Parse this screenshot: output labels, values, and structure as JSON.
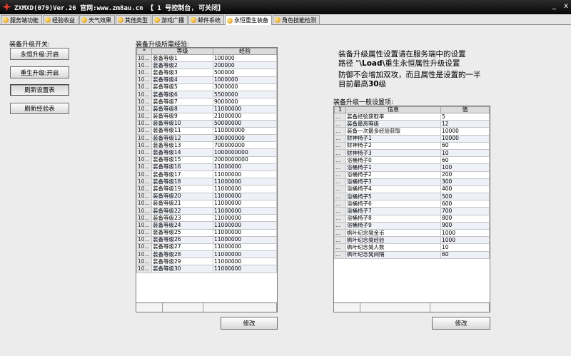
{
  "window": {
    "title": "ZXMXD(079)Ver.26 官网:www.zm8au.cn 【 1 号控制台, 可关闭】",
    "min_symbol": "_",
    "close_symbol": "x"
  },
  "tabs": [
    "服务端功能",
    "经验收益",
    "天气效果",
    "其他类型",
    "游戏广播",
    "邮件系统",
    "永恒重生装备",
    "角色技能检测"
  ],
  "left": {
    "section_label": "装备升级开关:",
    "btn_eternal": "永恒升级:开启",
    "btn_rebirth": "重生升级:开启",
    "btn_refresh_settings": "刷新设置表",
    "btn_refresh_exp": "刷新经验表"
  },
  "exp_table": {
    "label": "装备升级所需经验:",
    "headers": [
      "*",
      "等级",
      "经验"
    ],
    "rows": [
      [
        "10...",
        "装备等级1",
        "100000"
      ],
      [
        "10...",
        "装备等级2",
        "200000"
      ],
      [
        "10...",
        "装备等级3",
        "500000"
      ],
      [
        "10...",
        "装备等级4",
        "1000000"
      ],
      [
        "10...",
        "装备等级5",
        "3000000"
      ],
      [
        "10...",
        "装备等级6",
        "5500000"
      ],
      [
        "10...",
        "装备等级7",
        "9000000"
      ],
      [
        "10...",
        "装备等级8",
        "11000000"
      ],
      [
        "10...",
        "装备等级9",
        "21000000"
      ],
      [
        "10...",
        "装备等级10",
        "50000000"
      ],
      [
        "10...",
        "装备等级11",
        "110000000"
      ],
      [
        "10...",
        "装备等级12",
        "300000000"
      ],
      [
        "10...",
        "装备等级13",
        "700000000"
      ],
      [
        "10...",
        "装备等级14",
        "1000000000"
      ],
      [
        "10...",
        "装备等级15",
        "2000000000"
      ],
      [
        "10...",
        "装备等级16",
        "11000000"
      ],
      [
        "10...",
        "装备等级17",
        "11000000"
      ],
      [
        "10...",
        "装备等级18",
        "11000000"
      ],
      [
        "10...",
        "装备等级19",
        "11000000"
      ],
      [
        "10...",
        "装备等级20",
        "11000000"
      ],
      [
        "10...",
        "装备等级21",
        "11000000"
      ],
      [
        "10...",
        "装备等级22",
        "11000000"
      ],
      [
        "10...",
        "装备等级23",
        "11000000"
      ],
      [
        "10...",
        "装备等级24",
        "11000000"
      ],
      [
        "10...",
        "装备等级25",
        "11000000"
      ],
      [
        "10...",
        "装备等级26",
        "11000000"
      ],
      [
        "10...",
        "装备等级27",
        "11000000"
      ],
      [
        "10...",
        "装备等级28",
        "11000000"
      ],
      [
        "10...",
        "装备等级29",
        "11000000"
      ],
      [
        "10...",
        "装备等级30",
        "11000000"
      ]
    ],
    "modify_button": "修改"
  },
  "info": {
    "line1": "装备升级属性设置请在服务端中的设置",
    "line2_prefix": "路径 \"",
    "line2_bold": "\\Load\\",
    "line2_suffix": "重生永恒属性升级设置",
    "line3": "防御不会增加双攻，而且属性是设置的一半",
    "line4_prefix": "目前最高",
    "line4_bold": "30",
    "line4_suffix": "级"
  },
  "settings_table": {
    "label": "装备升级一般设置项:",
    "headers": [
      "1",
      "信息",
      "值"
    ],
    "rows": [
      [
        "...",
        "装备经验获取率",
        "5"
      ],
      [
        "...",
        "装备最高等级",
        "12"
      ],
      [
        "...",
        "装备一次最多经验获取",
        "10000"
      ],
      [
        "...",
        "财神椅子1",
        "10000"
      ],
      [
        "...",
        "财神椅子2",
        "60"
      ],
      [
        "...",
        "财神椅子3",
        "10"
      ],
      [
        "...",
        "浴桶椅子0",
        "60"
      ],
      [
        "...",
        "浴桶椅子1",
        "100"
      ],
      [
        "...",
        "浴桶椅子2",
        "200"
      ],
      [
        "...",
        "浴桶椅子3",
        "300"
      ],
      [
        "...",
        "浴桶椅子4",
        "400"
      ],
      [
        "...",
        "浴桶椅子5",
        "500"
      ],
      [
        "...",
        "浴桶椅子6",
        "600"
      ],
      [
        "...",
        "浴桶椅子7",
        "700"
      ],
      [
        "...",
        "浴桶椅子8",
        "800"
      ],
      [
        "...",
        "浴桶椅子9",
        "900"
      ],
      [
        "...",
        "枫叶纪念凳金币",
        "1000"
      ],
      [
        "...",
        "枫叶纪念凳经验",
        "1000"
      ],
      [
        "...",
        "枫叶纪念凳人数",
        "10"
      ],
      [
        "...",
        "枫叶纪念凳间隔",
        "60"
      ]
    ],
    "modify_button": "修改"
  }
}
